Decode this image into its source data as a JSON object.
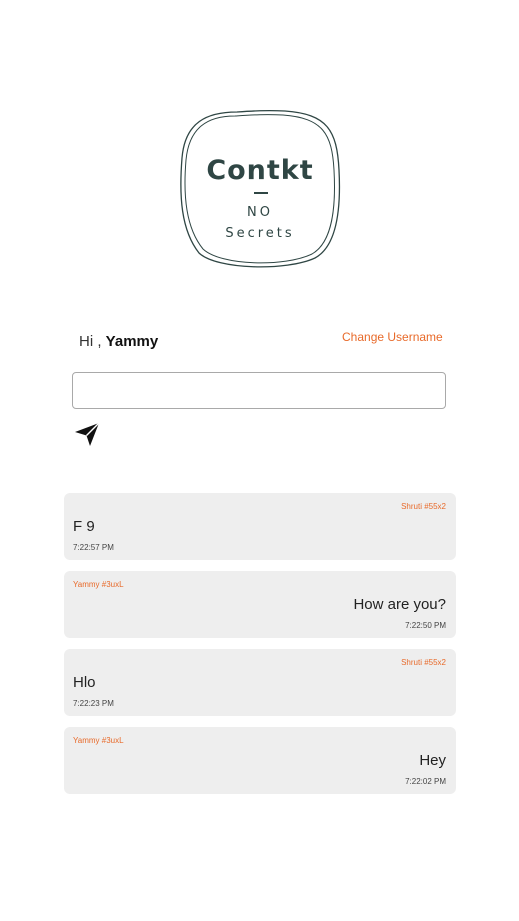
{
  "logo": {
    "title": "Contkt",
    "line1": "NO",
    "line2": "Secrets"
  },
  "greeting": {
    "prefix": "Hi ,",
    "username": "Yammy"
  },
  "change_username_label": "Change Username",
  "composer": {
    "value": "",
    "placeholder": "",
    "send_icon": "send-icon"
  },
  "messages": [
    {
      "sender": "Shruti #55x2",
      "text": "F 9",
      "time": "7:22:57 PM",
      "side": "left"
    },
    {
      "sender": "Yammy #3uxL",
      "text": "How are you?",
      "time": "7:22:50 PM",
      "side": "right"
    },
    {
      "sender": "Shruti #55x2",
      "text": "Hlo",
      "time": "7:22:23 PM",
      "side": "left"
    },
    {
      "sender": "Yammy #3uxL",
      "text": "Hey",
      "time": "7:22:02 PM",
      "side": "right"
    }
  ],
  "colors": {
    "accent": "#e86a2a",
    "logo": "#2f4644",
    "message_bg": "#eeeeee"
  }
}
